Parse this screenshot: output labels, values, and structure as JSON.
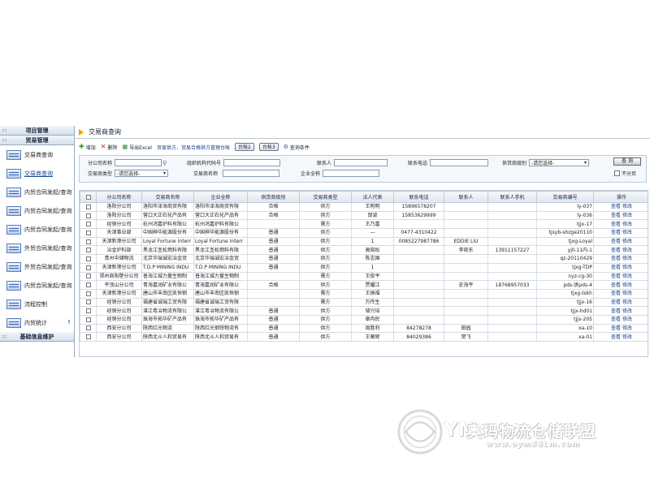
{
  "sidebar": {
    "groups": [
      {
        "label": "项目管理"
      },
      {
        "label": "贸易管理"
      }
    ],
    "items": [
      {
        "label": "交易商查询"
      },
      {
        "label": "交易商查询"
      },
      {
        "label": "内贸合同发起/查询"
      },
      {
        "label": "内贸合同发起/查询"
      },
      {
        "label": "内贸合同发起/查询"
      },
      {
        "label": "外贸合同发起/查询"
      },
      {
        "label": "外贸合同发起/查询"
      },
      {
        "label": "内贸合同发起/查询"
      },
      {
        "label": "流程控制"
      },
      {
        "label": "内贸统计"
      }
    ],
    "footer": "基础信息维护"
  },
  "main": {
    "title": "交易商查询",
    "toolbar": {
      "add": "增加",
      "delete": "删除",
      "export": "导出Excel",
      "link": "贸易供方、贸易合格供方管理台帐",
      "tab2": "台帐2",
      "tab3": "台帐3",
      "query_cond": "查询条件"
    },
    "search": {
      "company_name": "分公司名称",
      "org_code": "组织机构代码号",
      "contact": "联系人",
      "phone": "联系电话",
      "supplier_level": "供货商级别",
      "supplier_level_value": "-请您选择-",
      "trader_type": "交易商类型",
      "trader_type_value": "-请您选择-",
      "trader_name": "交易商名称",
      "full_name": "企业全称",
      "query_button": "查 询",
      "no_paging": "不分页"
    },
    "table": {
      "columns": [
        "",
        "分公司名称",
        "交易商名称",
        "企业全称",
        "供货商级别",
        "交易商类型",
        "法人代表",
        "联系电话",
        "联系人",
        "联系人手机",
        "交易商编号",
        "操作"
      ],
      "view": "查看",
      "edit": "修改",
      "rows": [
        [
          "洛阳分公司",
          "洛阳市泽海商贸有限",
          "洛阳市泽海商贸有限",
          "合格",
          "供方",
          "王明明",
          "15896578207",
          "",
          "",
          "ly-037"
        ],
        [
          "洛阳分公司",
          "营口大正石化产品有",
          "营口大正石化产品有",
          "合格",
          "供方",
          "邰波",
          "15853629999",
          "",
          "",
          "ly-036"
        ],
        [
          "经销分公司",
          "杭州鸿嘉炉料有限公",
          "杭州鸿嘉炉料有限公",
          "",
          "需方",
          "王乃富",
          "",
          "",
          "",
          "tjjx-17"
        ],
        [
          "天津事业部",
          "中国神华能源股份有",
          "中国神华能源股份有",
          "普通",
          "供方",
          "—",
          "0477-4310422",
          "",
          "",
          "tjsyb-shzge20110"
        ],
        [
          "天津新港分公司",
          "Loyal Fortune Interr",
          "Loyal Fortune Interr",
          "普通",
          "供方",
          "1",
          "0085227987786",
          "EDDIE LIU",
          "",
          "tjxg-Loyal"
        ],
        [
          "冶金炉料部",
          "黑龙江圣松燃料有限",
          "黑龙江圣松燃料有限",
          "普通",
          "供方",
          "高晓松",
          "",
          "李晓东",
          "13911157227",
          "yjll-11内-1"
        ],
        [
          "青州中储物流",
          "北京华瑞诚宏冶金贸",
          "北京华瑞诚宏冶金贸",
          "普通",
          "供方",
          "陈志国",
          "",
          "",
          "",
          "qz-20110429"
        ],
        [
          "天津新港分公司",
          "T.D.P MINING INDU",
          "T.D.P MINING INDU",
          "普通",
          "供方",
          "1",
          "",
          "",
          "",
          "tjxg-TDP"
        ],
        [
          "郑州商阳壁分公司",
          "普海江城力量生物制",
          "普海江城力量生物制",
          "",
          "需方",
          "王俊平",
          "",
          "",
          "",
          "nyz-cg-30"
        ],
        [
          "平顶山分公司",
          "青海嘉润矿业有限公",
          "青海嘉润矿业有限公",
          "合格",
          "供方",
          "贾耀江",
          "",
          "史海平",
          "18768957033",
          "pds-供pds-4"
        ],
        [
          "天津新港分公司",
          "唐山市丰南区凯恒钢",
          "唐山市丰南区凯恒钢",
          "",
          "需方",
          "王振福",
          "",
          "",
          "",
          "tjxg-tskh"
        ],
        [
          "经销分公司",
          "福建省诚瑞工贸有限",
          "福建省诚瑞工贸有限",
          "",
          "需方",
          "万传生",
          "",
          "",
          "",
          "tjjx-16"
        ],
        [
          "经销分公司",
          "湛江粤冶物流有限公",
          "湛江粤冶物流有限公",
          "普通",
          "供方",
          "邹兴培",
          "",
          "",
          "",
          "tjjx-hd01"
        ],
        [
          "经销分公司",
          "珠海市拓华矿产品有",
          "珠海市拓华矿产品有",
          "普通",
          "供方",
          "章冉民",
          "",
          "",
          "",
          "tjjx-205"
        ],
        [
          "西安分公司",
          "陕西红光物流",
          "陕西红光钢铁物流有",
          "普通",
          "供方",
          "周胜利",
          "84278278",
          "田园",
          "",
          "xa-10"
        ],
        [
          "西安分公司",
          "陕西北斗人和贸易有",
          "陕西北斗人和贸易有",
          "普通",
          "供方",
          "王雁辉",
          "84029386",
          "贺飞",
          "",
          "xa-01"
        ]
      ]
    }
  },
  "watermark": {
    "text": "奥玛物流仓储联盟",
    "url": "www.oym56Lm.com",
    "mark": "YM"
  }
}
